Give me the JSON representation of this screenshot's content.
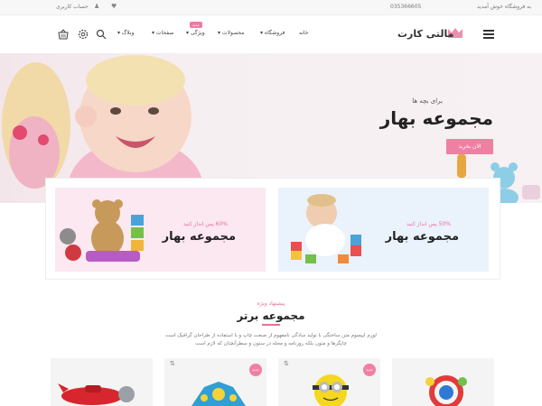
{
  "topbar": {
    "welcome": "به فروشگاه خوش آمدید",
    "phone": "035366605",
    "account": "حساب کاربری",
    "icons": [
      "heart-icon",
      "user-icon"
    ]
  },
  "header": {
    "logo": "مالتی کارت",
    "nav": [
      {
        "label": "خانه"
      },
      {
        "label": "فروشگاه"
      },
      {
        "label": "محصولات"
      },
      {
        "label": "ویژگی"
      },
      {
        "label": "صفحات"
      },
      {
        "label": "وبلاگ"
      }
    ],
    "nav_badge": "جدید",
    "icons": [
      "search-icon",
      "settings-icon",
      "cart-icon",
      "menu-icon"
    ]
  },
  "hero": {
    "subtitle": "برای بچه ها",
    "title": "مجموعه بهار",
    "button": "الان بخرید"
  },
  "promos": [
    {
      "off": "50% پس انداز کنید",
      "name": "مجموعه بهار"
    },
    {
      "off": "60% پس انداز کنید",
      "name": "مجموعه بهار"
    }
  ],
  "section": {
    "kicker": "پیشنهاد ویژه",
    "title": "مجموعه برتر",
    "description": "لورم ایپسوم متن ساختگی با تولید سادگی نامفهوم از صنعت چاپ و با استفاده از طراحان گرافیک است چاپگرها و متون بلکه روزنامه و مجله در ستون و سطرآنچنان که لازم است"
  },
  "cards": [
    {
      "badge": ""
    },
    {
      "badge": "جدید"
    },
    {
      "badge": "جدید"
    },
    {
      "badge": ""
    }
  ],
  "colors": {
    "accent": "#f080a3",
    "text": "#222222"
  }
}
